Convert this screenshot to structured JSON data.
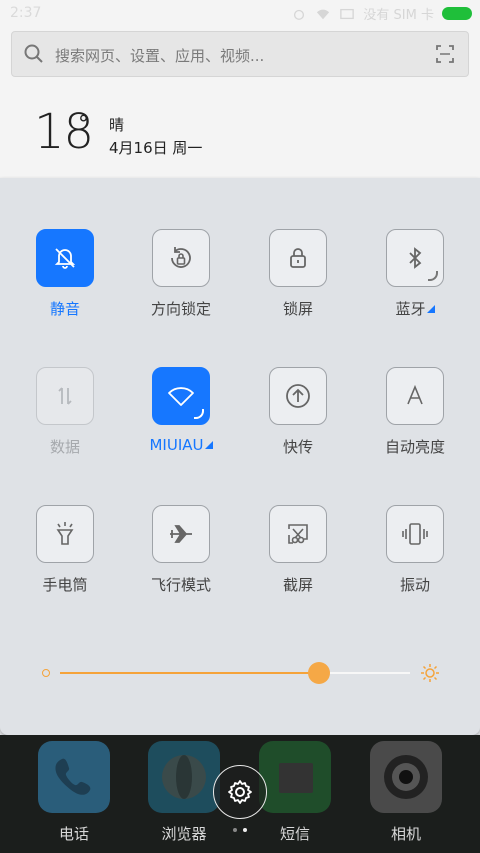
{
  "status_bar": {
    "time": "2:37",
    "signal_text": "没有 SIM 卡"
  },
  "search": {
    "placeholder": "搜索网页、设置、应用、视频..."
  },
  "weather": {
    "temperature": "18",
    "degree": "°",
    "condition": "晴",
    "date": "4月16日 周一"
  },
  "toggles": [
    {
      "label": "静音",
      "icon": "bell-off-icon",
      "state": "on"
    },
    {
      "label": "方向锁定",
      "icon": "rotation-lock-icon",
      "state": "off"
    },
    {
      "label": "锁屏",
      "icon": "lock-icon",
      "state": "off"
    },
    {
      "label": "蓝牙",
      "icon": "bluetooth-icon",
      "state": "off"
    },
    {
      "label": "数据",
      "icon": "mobile-data-icon",
      "state": "disabled"
    },
    {
      "label": "MIUIAU",
      "icon": "wifi-icon",
      "state": "on"
    },
    {
      "label": "快传",
      "icon": "quick-transfer-icon",
      "state": "off"
    },
    {
      "label": "自动亮度",
      "icon": "auto-brightness-icon",
      "state": "off"
    },
    {
      "label": "手电筒",
      "icon": "flashlight-icon",
      "state": "off"
    },
    {
      "label": "飞行模式",
      "icon": "airplane-icon",
      "state": "off"
    },
    {
      "label": "截屏",
      "icon": "screenshot-icon",
      "state": "off"
    },
    {
      "label": "振动",
      "icon": "vibrate-icon",
      "state": "off"
    }
  ],
  "brightness": {
    "level": 0.74
  },
  "dock": [
    {
      "label": "电话",
      "icon": "phone-icon"
    },
    {
      "label": "浏览器",
      "icon": "browser-icon"
    },
    {
      "label": "短信",
      "icon": "messages-icon"
    },
    {
      "label": "相机",
      "icon": "camera-icon"
    }
  ],
  "colors": {
    "accent": "#1677ff",
    "brightness": "#f5a33a"
  }
}
